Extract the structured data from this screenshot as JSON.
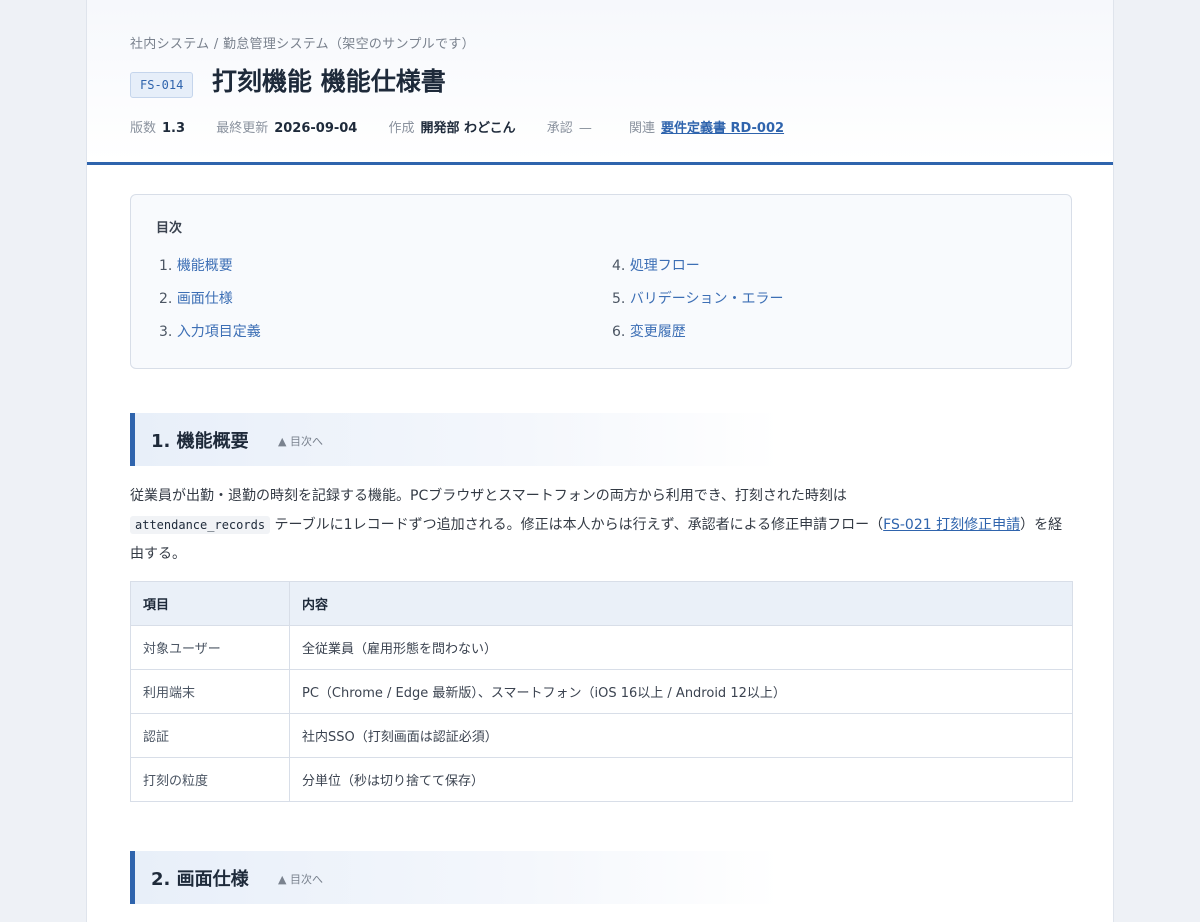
{
  "header": {
    "breadcrumb": "社内システム / 勤怠管理システム（架空のサンプルです）",
    "doc_id": "FS-014",
    "title": "打刻機能 機能仕様書",
    "meta": {
      "version_label": "版数",
      "version": "1.3",
      "updated_label": "最終更新",
      "updated": "2026-09-04",
      "author_label": "作成",
      "author": "開発部 わどこん",
      "approval_label": "承認",
      "approval": "—",
      "related_label": "関連",
      "related_link": "要件定義書 RD-002"
    }
  },
  "toc": {
    "title": "目次",
    "items": [
      {
        "num": "1.",
        "label": "機能概要"
      },
      {
        "num": "2.",
        "label": "画面仕様"
      },
      {
        "num": "3.",
        "label": "入力項目定義"
      },
      {
        "num": "4.",
        "label": "処理フロー"
      },
      {
        "num": "5.",
        "label": "バリデーション・エラー"
      },
      {
        "num": "6.",
        "label": "変更履歴"
      }
    ]
  },
  "sections": [
    {
      "title": "1. 機能概要",
      "back_link": "▲ 目次へ"
    },
    {
      "title": "2. 画面仕様",
      "back_link": "▲ 目次へ"
    }
  ],
  "overview": {
    "text_1": "従業員が出勤・退勤の時刻を記録する機能。PCブラウザとスマートフォンの両方から利用でき、打刻された時刻は",
    "code": "attendance_records",
    "text_2": " テーブルに1レコードずつ追加される。修正は本人からは行えず、承認者による修正申請フロー（",
    "link": "FS-021 打刻修正申請",
    "text_3": "）を経由する。"
  },
  "spec_table": {
    "headers": [
      "項目",
      "内容"
    ],
    "rows": [
      [
        "対象ユーザー",
        "全従業員（雇用形態を問わない）"
      ],
      [
        "利用端末",
        "PC（Chrome / Edge 最新版）、スマートフォン（iOS 16以上 / Android 12以上）"
      ],
      [
        "認証",
        "社内SSO（打刻画面は認証必須）"
      ],
      [
        "打刻の粒度",
        "分単位（秒は切り捨てて保存）"
      ]
    ]
  },
  "colors": {
    "accent": "#2f64ad",
    "link": "#3d6fb5",
    "table_header_bg": "#eaf0f8"
  }
}
